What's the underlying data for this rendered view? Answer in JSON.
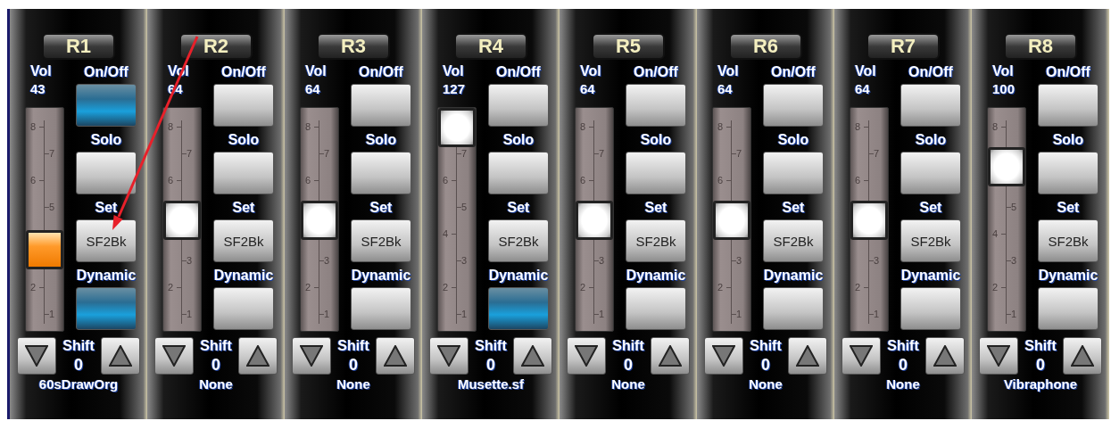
{
  "strips": [
    {
      "title": "R1",
      "selected": true,
      "vol_label": "Vol",
      "vol_value": "43",
      "level": 0.34,
      "scale_above": [
        "8",
        "7",
        "6",
        "5"
      ],
      "scale_below": [
        "2",
        "1"
      ],
      "buttons": [
        {
          "kind": "toggle",
          "label": "On/Off",
          "on": true
        },
        {
          "kind": "toggle",
          "label": "Solo",
          "on": false
        },
        {
          "kind": "text",
          "label": "Set",
          "text": "SF2Bk"
        },
        {
          "kind": "toggle",
          "label": "Dynamic",
          "on": true
        }
      ],
      "shift_label": "Shift",
      "shift_value": "0",
      "instrument": "60sDrawOrg"
    },
    {
      "title": "R2",
      "selected": false,
      "vol_label": "Vol",
      "vol_value": "64",
      "level": 0.5,
      "scale_above": [
        "8",
        "7",
        "6"
      ],
      "scale_below": [
        "3",
        "2",
        "1"
      ],
      "buttons": [
        {
          "kind": "toggle",
          "label": "On/Off",
          "on": false
        },
        {
          "kind": "toggle",
          "label": "Solo",
          "on": false
        },
        {
          "kind": "text",
          "label": "Set",
          "text": "SF2Bk"
        },
        {
          "kind": "toggle",
          "label": "Dynamic",
          "on": false
        }
      ],
      "shift_label": "Shift",
      "shift_value": "0",
      "instrument": "None"
    },
    {
      "title": "R3",
      "selected": false,
      "vol_label": "Vol",
      "vol_value": "64",
      "level": 0.5,
      "scale_above": [
        "8",
        "7",
        "6"
      ],
      "scale_below": [
        "3",
        "2",
        "1"
      ],
      "buttons": [
        {
          "kind": "toggle",
          "label": "On/Off",
          "on": false
        },
        {
          "kind": "toggle",
          "label": "Solo",
          "on": false
        },
        {
          "kind": "text",
          "label": "Set",
          "text": "SF2Bk"
        },
        {
          "kind": "toggle",
          "label": "Dynamic",
          "on": false
        }
      ],
      "shift_label": "Shift",
      "shift_value": "0",
      "instrument": "None"
    },
    {
      "title": "R4",
      "selected": false,
      "vol_label": "Vol",
      "vol_value": "127",
      "level": 1,
      "scale_below": [
        "7",
        "6",
        "5",
        "4",
        "3",
        "2",
        "1"
      ],
      "buttons": [
        {
          "kind": "toggle",
          "label": "On/Off",
          "on": false
        },
        {
          "kind": "toggle",
          "label": "Solo",
          "on": false
        },
        {
          "kind": "text",
          "label": "Set",
          "text": "SF2Bk"
        },
        {
          "kind": "toggle",
          "label": "Dynamic",
          "on": true
        }
      ],
      "shift_label": "Shift",
      "shift_value": "0",
      "instrument": "Musette.sf"
    },
    {
      "title": "R5",
      "selected": false,
      "vol_label": "Vol",
      "vol_value": "64",
      "level": 0.5,
      "scale_above": [
        "8",
        "7",
        "6"
      ],
      "scale_below": [
        "3",
        "2",
        "1"
      ],
      "buttons": [
        {
          "kind": "toggle",
          "label": "On/Off",
          "on": false
        },
        {
          "kind": "toggle",
          "label": "Solo",
          "on": false
        },
        {
          "kind": "text",
          "label": "Set",
          "text": "SF2Bk"
        },
        {
          "kind": "toggle",
          "label": "Dynamic",
          "on": false
        }
      ],
      "shift_label": "Shift",
      "shift_value": "0",
      "instrument": "None"
    },
    {
      "title": "R6",
      "selected": false,
      "vol_label": "Vol",
      "vol_value": "64",
      "level": 0.5,
      "scale_above": [
        "8",
        "7",
        "6"
      ],
      "scale_below": [
        "3",
        "2",
        "1"
      ],
      "buttons": [
        {
          "kind": "toggle",
          "label": "On/Off",
          "on": false
        },
        {
          "kind": "toggle",
          "label": "Solo",
          "on": false
        },
        {
          "kind": "text",
          "label": "Set",
          "text": "SF2Bk"
        },
        {
          "kind": "toggle",
          "label": "Dynamic",
          "on": false
        }
      ],
      "shift_label": "Shift",
      "shift_value": "0",
      "instrument": "None"
    },
    {
      "title": "R7",
      "selected": false,
      "vol_label": "Vol",
      "vol_value": "64",
      "level": 0.5,
      "scale_above": [
        "8",
        "7",
        "6"
      ],
      "scale_below": [
        "3",
        "2",
        "1"
      ],
      "buttons": [
        {
          "kind": "toggle",
          "label": "On/Off",
          "on": false
        },
        {
          "kind": "toggle",
          "label": "Solo",
          "on": false
        },
        {
          "kind": "text",
          "label": "Set",
          "text": "SF2Bk"
        },
        {
          "kind": "toggle",
          "label": "Dynamic",
          "on": false
        }
      ],
      "shift_label": "Shift",
      "shift_value": "0",
      "instrument": "None"
    },
    {
      "title": "R8",
      "selected": false,
      "vol_label": "Vol",
      "vol_value": "100",
      "level": 0.79,
      "scale_above": [
        "8"
      ],
      "scale_below": [
        "5",
        "4",
        "3",
        "2",
        "1"
      ],
      "buttons": [
        {
          "kind": "toggle",
          "label": "On/Off",
          "on": false
        },
        {
          "kind": "toggle",
          "label": "Solo",
          "on": false
        },
        {
          "kind": "text",
          "label": "Set",
          "text": "SF2Bk"
        },
        {
          "kind": "toggle",
          "label": "Dynamic",
          "on": false
        }
      ],
      "shift_label": "Shift",
      "shift_value": "0",
      "instrument": "Vibraphone"
    }
  ]
}
